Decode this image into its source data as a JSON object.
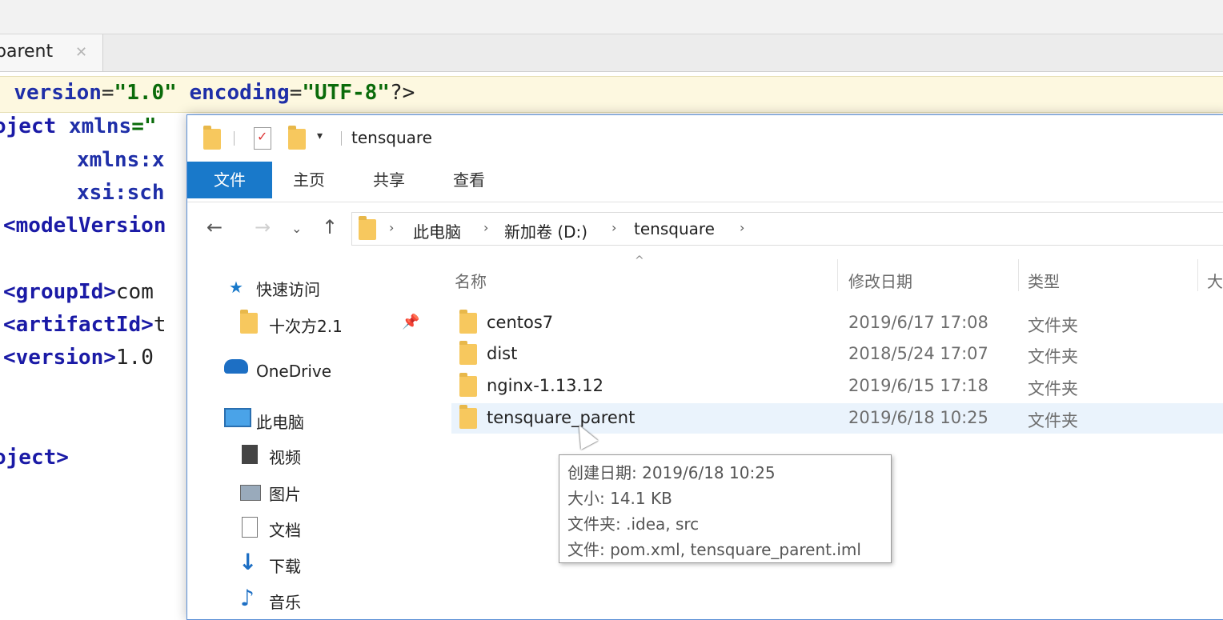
{
  "ide": {
    "tab_label": "parent",
    "tab_close": "✕",
    "code_lines": {
      "l1_a": "l ",
      "l1_b": "version",
      "l1_c": "=",
      "l1_d": "\"1.0\"",
      "l1_e": " ",
      "l1_f": "encoding",
      "l1_g": "=",
      "l1_h": "\"UTF-8\"",
      "l1_i": "?>",
      "l2_a": "oject ",
      "l2_b": "xmlns",
      "l2_c": "=\"",
      "l3": "xmlns:x",
      "l4": "xsi:sch",
      "l5": "<modelVersion",
      "l6_a": "<groupId>",
      "l6_b": "com",
      "l7_a": "<artifactId>",
      "l7_b": "t",
      "l8_a": "<version>",
      "l8_b": "1.0",
      "l9": "oject>"
    }
  },
  "explorer": {
    "title": "tensquare",
    "ribbon_tabs": [
      "文件",
      "主页",
      "共享",
      "查看"
    ],
    "breadcrumb": [
      "此电脑",
      "新加卷 (D:)",
      "tensquare"
    ],
    "nav": {
      "quick_access": "快速访问",
      "pinned_folder": "十次方2.1",
      "onedrive": "OneDrive",
      "this_pc": "此电脑",
      "videos": "视频",
      "pictures": "图片",
      "documents": "文档",
      "downloads": "下载",
      "music": "音乐"
    },
    "columns": {
      "name": "名称",
      "modified": "修改日期",
      "type": "类型",
      "size": "大"
    },
    "files": [
      {
        "name": "centos7",
        "modified": "2019/6/17 17:08",
        "type": "文件夹"
      },
      {
        "name": "dist",
        "modified": "2018/5/24 17:07",
        "type": "文件夹"
      },
      {
        "name": "nginx-1.13.12",
        "modified": "2019/6/15 17:18",
        "type": "文件夹"
      },
      {
        "name": "tensquare_parent",
        "modified": "2019/6/18 10:25",
        "type": "文件夹"
      }
    ],
    "tooltip": {
      "created": "创建日期: 2019/6/18 10:25",
      "size": "大小: 14.1 KB",
      "folders": "文件夹: .idea, src",
      "files": "文件: pom.xml, tensquare_parent.iml"
    },
    "colors": {
      "accent": "#1979ca",
      "folder": "#f7c85e",
      "selection": "#eaf3fc"
    }
  }
}
